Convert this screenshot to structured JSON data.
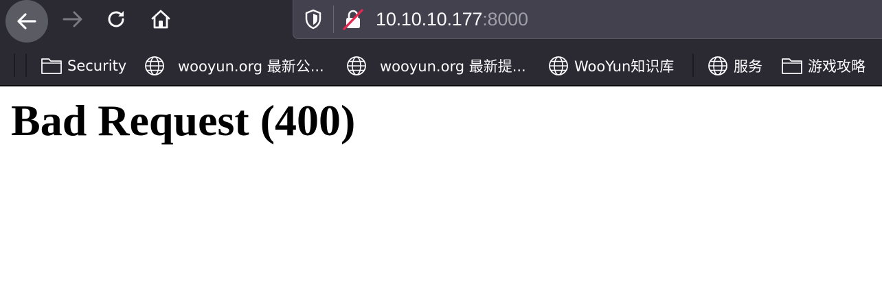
{
  "toolbar": {
    "icons": {
      "back": "back-arrow-icon",
      "forward": "forward-arrow-icon",
      "reload": "reload-icon",
      "home": "home-icon"
    }
  },
  "urlbar": {
    "host": "10.10.10.177",
    "port": ":8000",
    "icons": {
      "tracking": "shield-icon",
      "insecure": "insecure-lock-icon"
    }
  },
  "bookmarks": [
    {
      "label": "Security",
      "icon": "folder-icon"
    },
    {
      "label": "wooyun.org 最新公...",
      "icon": "globe-icon"
    },
    {
      "label": "wooyun.org 最新提...",
      "icon": "globe-icon"
    },
    {
      "label": "WooYun知识库",
      "icon": "globe-icon"
    },
    {
      "label": "服务",
      "icon": "globe-icon"
    },
    {
      "label": "游戏攻略",
      "icon": "folder-icon"
    }
  ],
  "page": {
    "heading": "Bad Request (400)"
  },
  "colors": {
    "chrome_bg": "#2b2a33",
    "urlbar_bg": "#42414d",
    "text_light": "#fbfbfe",
    "port_text": "#9e9ea6",
    "insecure_red": "#e22850"
  }
}
